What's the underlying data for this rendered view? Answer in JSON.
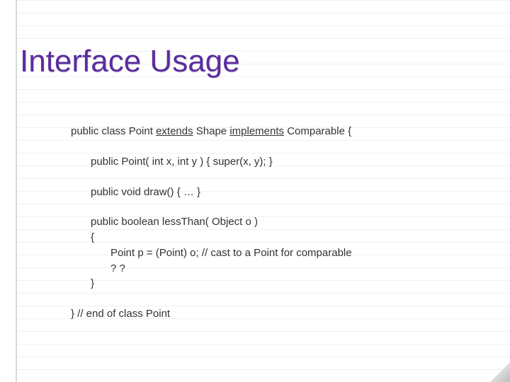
{
  "title": "Interface Usage",
  "code": {
    "l1a": "public class Point ",
    "kw_extends": "extends",
    "l1b": " Shape ",
    "kw_implements": "implements",
    "l1c": " Comparable {",
    "l2": "public Point( int x, int y ) { super(x, y); }",
    "l3": "public void draw() { … }",
    "l4": "public boolean lessThan( Object o )",
    "l5": "{",
    "l6": "Point p = (Point) o; // cast to a Point for comparable",
    "l7": "? ?",
    "l8": "}",
    "l9": "} // end of class Point"
  }
}
